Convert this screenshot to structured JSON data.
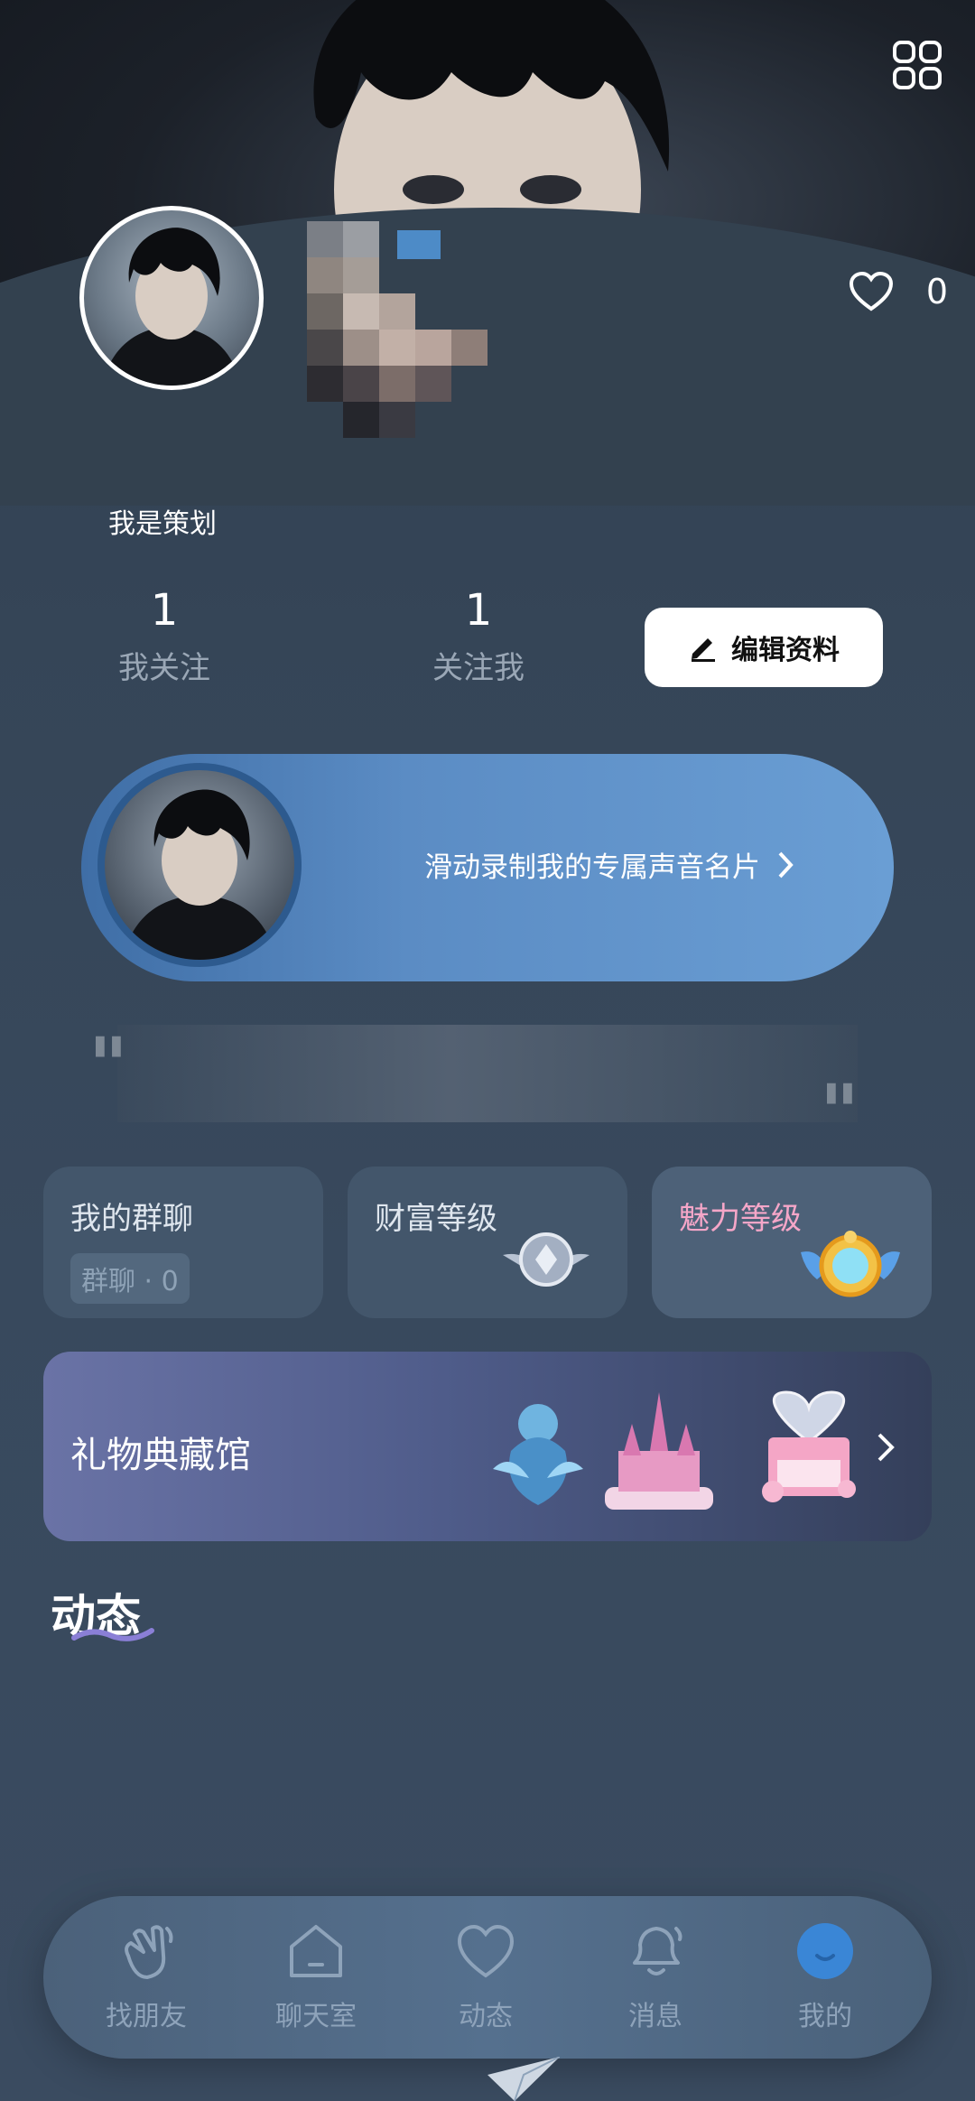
{
  "profile": {
    "nickname": "我是策划",
    "likes_count": "0"
  },
  "stats": {
    "following_value": "1",
    "following_label": "我关注",
    "followers_value": "1",
    "followers_label": "关注我"
  },
  "edit_button": {
    "label": "编辑资料"
  },
  "voice_card": {
    "label": "滑动录制我的专属声音名片"
  },
  "cards": {
    "group_chat": {
      "title": "我的群聊",
      "badge": "群聊 · 0"
    },
    "wealth_level": {
      "title": "财富等级"
    },
    "charm_level": {
      "title": "魅力等级"
    }
  },
  "gift_hall": {
    "title": "礼物典藏馆"
  },
  "feed": {
    "title": "动态"
  },
  "nav": {
    "items": [
      {
        "label": "找朋友",
        "icon": "wave-hand-icon"
      },
      {
        "label": "聊天室",
        "icon": "home-icon"
      },
      {
        "label": "动态",
        "icon": "heart-icon"
      },
      {
        "label": "消息",
        "icon": "bell-icon"
      },
      {
        "label": "我的",
        "icon": "me-icon"
      }
    ]
  },
  "colors": {
    "accent_blue": "#5b8cc4",
    "charm_pink": "#f5a6c8",
    "nav_active": "#3a86d6"
  }
}
